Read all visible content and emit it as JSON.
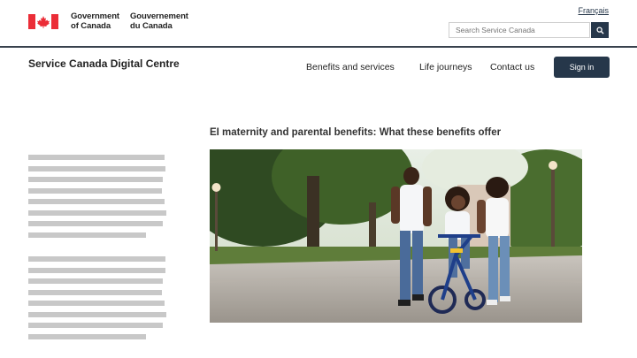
{
  "header": {
    "government_en": "Government\nof Canada",
    "government_fr": "Gouvernement\ndu Canada",
    "language_link": "Français",
    "search_placeholder": "Search Service Canada"
  },
  "site": {
    "title": "Service Canada Digital Centre",
    "nav": [
      "Benefits and services",
      "Life journeys",
      "Contact us"
    ],
    "signin_label": "Sign in"
  },
  "main": {
    "heading": "EI maternity and parental benefits: What these benefits offer",
    "image_icon": "family-bicycle-photo"
  },
  "colors": {
    "brand_red": "#eb2d37",
    "navy": "#26374a",
    "placeholder_grey": "#c8c8c8"
  }
}
